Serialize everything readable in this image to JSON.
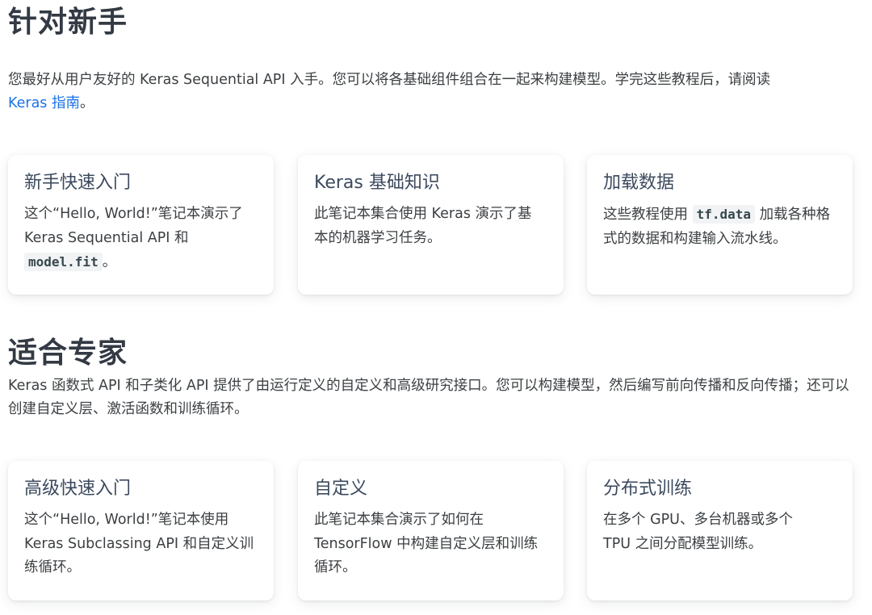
{
  "beginners": {
    "heading": "针对新手",
    "intro_text": "您最好从用户友好的 Keras Sequential API 入手。您可以将各基础组件组合在一起来构建模型。学完这些教程后，请阅读",
    "intro_link": "Keras 指南",
    "intro_end": "。",
    "cards": [
      {
        "title": "新手快速入门",
        "text_before": "这个“Hello, World!”笔记本演示了 Keras Sequential API 和",
        "code": "model.fit",
        "text_after": "。"
      },
      {
        "title": "Keras 基础知识",
        "text_before": "此笔记本集合使用 Keras 演示了基本的机器学习任务。",
        "code": "",
        "text_after": ""
      },
      {
        "title": "加载数据",
        "text_before": "这些教程使用",
        "code": "tf.data",
        "text_after": "加载各种格式的数据和构建输入流水线。"
      }
    ]
  },
  "experts": {
    "heading": "适合专家",
    "intro_text": "Keras 函数式 API 和子类化 API 提供了由运行定义的自定义和高级研究接口。您可以构建模型，然后编写前向传播和反向传播；还可以创建自定义层、激活函数和训练循环。",
    "cards": [
      {
        "title": "高级快速入门",
        "text": "这个“Hello, World!”笔记本使用 Keras Subclassing API 和自定义训练循环。"
      },
      {
        "title": "自定义",
        "text": "此笔记本集合演示了如何在 TensorFlow 中构建自定义层和训练循环。"
      },
      {
        "title": "分布式训练",
        "text": "在多个 GPU、多台机器或多个 TPU 之间分配模型训练。"
      }
    ]
  }
}
